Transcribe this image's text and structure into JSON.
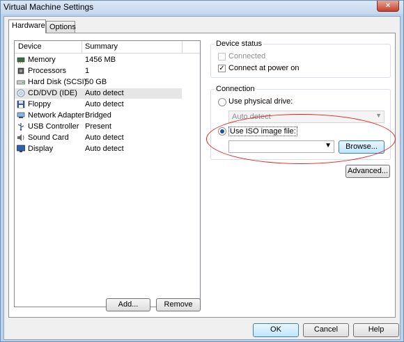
{
  "window": {
    "title": "Virtual Machine Settings",
    "close_label": "×"
  },
  "tabs": [
    {
      "label": "Hardware"
    },
    {
      "label": "Options"
    }
  ],
  "device_list": {
    "columns": {
      "device": "Device",
      "summary": "Summary"
    },
    "rows": [
      {
        "name": "Memory",
        "summary": "1456 MB",
        "icon": "memory-icon"
      },
      {
        "name": "Processors",
        "summary": "1",
        "icon": "processor-icon"
      },
      {
        "name": "Hard Disk (SCSI)",
        "summary": "50 GB",
        "icon": "hard-disk-icon"
      },
      {
        "name": "CD/DVD (IDE)",
        "summary": "Auto detect",
        "icon": "cd-dvd-icon"
      },
      {
        "name": "Floppy",
        "summary": "Auto detect",
        "icon": "floppy-icon"
      },
      {
        "name": "Network Adapter",
        "summary": "Bridged",
        "icon": "network-adapter-icon"
      },
      {
        "name": "USB Controller",
        "summary": "Present",
        "icon": "usb-controller-icon"
      },
      {
        "name": "Sound Card",
        "summary": "Auto detect",
        "icon": "sound-card-icon"
      },
      {
        "name": "Display",
        "summary": "Auto detect",
        "icon": "display-icon"
      }
    ],
    "selected": "CD/DVD (IDE)"
  },
  "list_buttons": {
    "add": "Add...",
    "remove": "Remove"
  },
  "device_status": {
    "title": "Device status",
    "connected": {
      "label": "Connected",
      "checked": false,
      "enabled": false
    },
    "connect_at_power_on": {
      "label": "Connect at power on",
      "checked": true
    }
  },
  "connection": {
    "title": "Connection",
    "physical": {
      "label": "Use physical drive:",
      "selected": false
    },
    "physical_drive_value": "Auto detect",
    "iso": {
      "label": "Use ISO image file:",
      "selected": true
    },
    "iso_path": "",
    "browse": "Browse...",
    "advanced": "Advanced..."
  },
  "footer": {
    "ok": "OK",
    "cancel": "Cancel",
    "help": "Help"
  },
  "colors": {
    "annotation_ellipse": "#e02020",
    "window_frame": "#b9d1ea"
  }
}
